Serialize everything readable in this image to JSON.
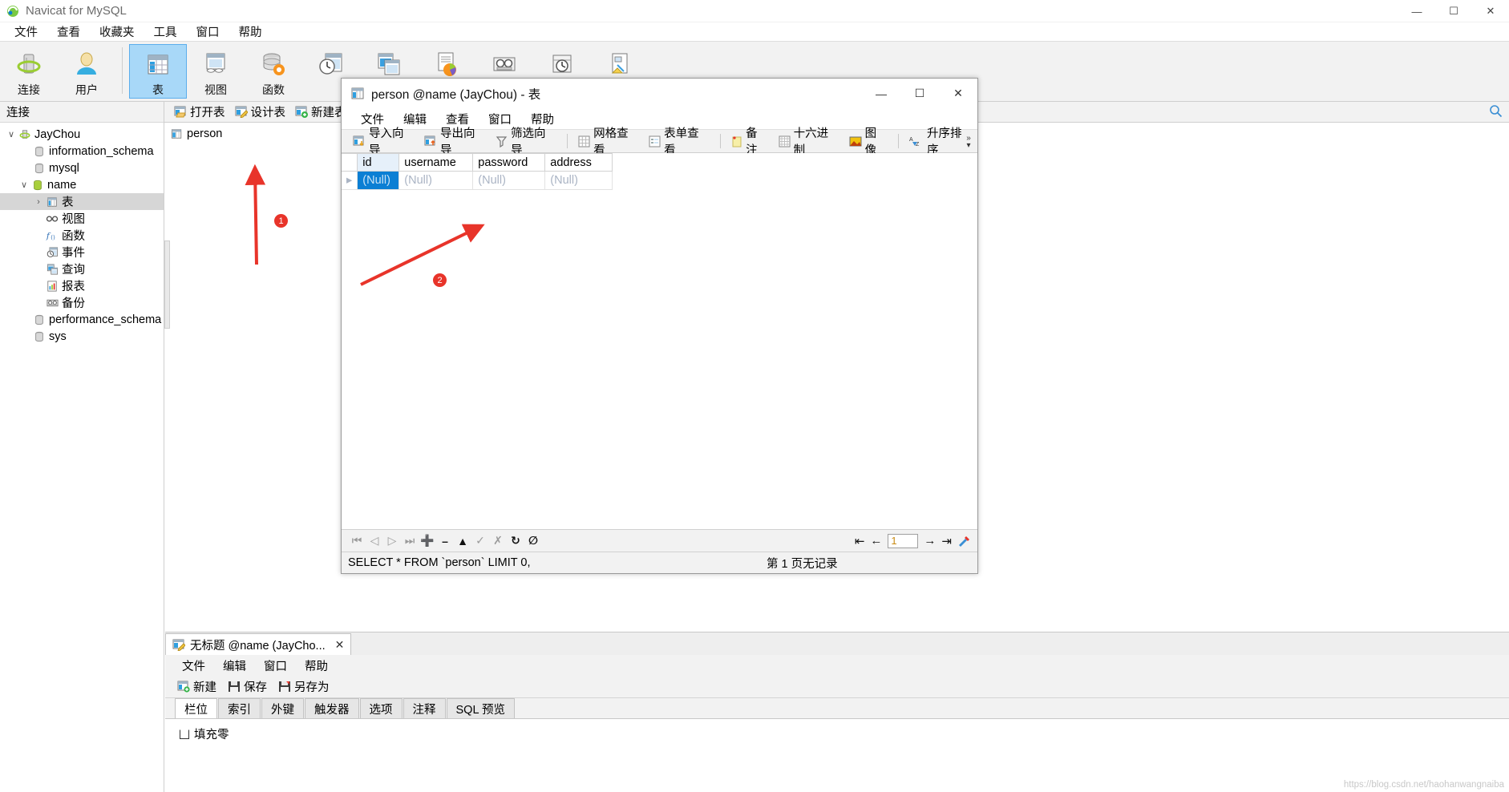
{
  "app": {
    "title": "Navicat for MySQL",
    "icon": "navicat-logo-icon",
    "window_buttons": {
      "minimize": "—",
      "maximize": "☐",
      "close": "✕"
    },
    "menus": [
      "文件",
      "查看",
      "收藏夹",
      "工具",
      "窗口",
      "帮助"
    ],
    "toolbar": [
      {
        "label": "连接",
        "icon": "connection-icon",
        "active": false
      },
      {
        "label": "用户",
        "icon": "user-icon",
        "active": false
      },
      {
        "label": "表",
        "icon": "table-icon",
        "active": true
      },
      {
        "label": "视图",
        "icon": "view-icon",
        "active": false
      },
      {
        "label": "函数",
        "icon": "function-icon",
        "active": false
      },
      {
        "label": "",
        "icon": "event-icon",
        "active": false
      },
      {
        "label": "",
        "icon": "query-icon",
        "active": false
      },
      {
        "label": "",
        "icon": "report-icon",
        "active": false
      },
      {
        "label": "",
        "icon": "backup-icon",
        "active": false
      },
      {
        "label": "",
        "icon": "schedule-icon",
        "active": false
      },
      {
        "label": "",
        "icon": "model-icon",
        "active": false
      }
    ]
  },
  "sidebar": {
    "header": "连接",
    "tree": [
      {
        "label": "JayChou",
        "icon": "connection-icon",
        "indent": 0,
        "twisty": "∨",
        "selected": false
      },
      {
        "label": "information_schema",
        "icon": "database-gray-icon",
        "indent": 1,
        "twisty": "",
        "selected": false
      },
      {
        "label": "mysql",
        "icon": "database-gray-icon",
        "indent": 1,
        "twisty": "",
        "selected": false
      },
      {
        "label": "name",
        "icon": "database-green-icon",
        "indent": 1,
        "twisty": "∨",
        "selected": false
      },
      {
        "label": "表",
        "icon": "table-icon",
        "indent": 2,
        "twisty": "›",
        "selected": true
      },
      {
        "label": "视图",
        "icon": "view-glasses-icon",
        "indent": 2,
        "twisty": "",
        "selected": false
      },
      {
        "label": "函数",
        "icon": "function-fx-icon",
        "indent": 2,
        "twisty": "",
        "selected": false
      },
      {
        "label": "事件",
        "icon": "event-icon",
        "indent": 2,
        "twisty": "",
        "selected": false
      },
      {
        "label": "查询",
        "icon": "query-icon",
        "indent": 2,
        "twisty": "",
        "selected": false
      },
      {
        "label": "报表",
        "icon": "report-icon",
        "indent": 2,
        "twisty": "",
        "selected": false
      },
      {
        "label": "备份",
        "icon": "backup-tape-icon",
        "indent": 2,
        "twisty": "",
        "selected": false
      },
      {
        "label": "performance_schema",
        "icon": "database-gray-icon",
        "indent": 1,
        "twisty": "",
        "selected": false
      },
      {
        "label": "sys",
        "icon": "database-gray-icon",
        "indent": 1,
        "twisty": "",
        "selected": false
      }
    ]
  },
  "main": {
    "toolbar": [
      {
        "label": "打开表",
        "icon": "open-table-icon"
      },
      {
        "label": "设计表",
        "icon": "design-table-icon"
      },
      {
        "label": "新建表",
        "icon": "new-table-icon"
      }
    ],
    "search_icon": "search-icon",
    "objects": [
      {
        "label": "person",
        "icon": "table-icon"
      }
    ]
  },
  "designer": {
    "tab_title": "无标题 @name (JayCho...",
    "tab_icon": "design-table-icon",
    "tab_close": "✕",
    "menus": [
      "文件",
      "编辑",
      "窗口",
      "帮助"
    ],
    "toolbar": [
      {
        "label": "新建",
        "icon": "new-icon"
      },
      {
        "label": "保存",
        "icon": "save-icon"
      },
      {
        "label": "另存为",
        "icon": "save-as-icon"
      }
    ],
    "subtabs": [
      "栏位",
      "索引",
      "外键",
      "触发器",
      "选项",
      "注释",
      "SQL 预览"
    ],
    "active_subtab": "栏位",
    "checkbox_label": "填充零",
    "checkbox_checked": false
  },
  "child_window": {
    "title": "person @name (JayChou) - 表",
    "title_icon": "table-icon",
    "window_buttons": {
      "minimize": "—",
      "maximize": "☐",
      "close": "✕"
    },
    "menus": [
      "文件",
      "编辑",
      "查看",
      "窗口",
      "帮助"
    ],
    "toolbar": [
      {
        "label": "导入向导",
        "icon": "import-wizard-icon",
        "group": 0
      },
      {
        "label": "导出向导",
        "icon": "export-wizard-icon",
        "group": 0
      },
      {
        "label": "筛选向导",
        "icon": "filter-wizard-icon",
        "group": 0
      },
      {
        "label": "网格查看",
        "icon": "grid-view-icon",
        "group": 1
      },
      {
        "label": "表单查看",
        "icon": "form-view-icon",
        "group": 1
      },
      {
        "label": "备注",
        "icon": "memo-icon",
        "group": 2
      },
      {
        "label": "十六进制",
        "icon": "hex-icon",
        "group": 2
      },
      {
        "label": "图像",
        "icon": "image-icon",
        "group": 2
      },
      {
        "label": "升序排序",
        "icon": "sort-asc-icon",
        "group": 3
      }
    ],
    "overflow_icon": "chevron-more-icon",
    "grid": {
      "columns": [
        "id",
        "username",
        "password",
        "address"
      ],
      "rows": [
        {
          "marker": "▸",
          "cells": [
            "(Null)",
            "(Null)",
            "(Null)",
            "(Null)"
          ],
          "selected_cell": 0
        }
      ]
    },
    "navbar": {
      "icons": [
        "first-record-icon",
        "prev-record-icon",
        "next-record-icon",
        "last-record-icon",
        "add-record-icon",
        "delete-record-icon",
        "apply-change-icon",
        "confirm-edit-icon",
        "cancel-edit-icon",
        "refresh-icon",
        "stop-icon"
      ],
      "page_value": "1",
      "page_first": "⇤",
      "page_prev": "←",
      "page_next": "→",
      "page_last": "⇥",
      "tools_icon": "tools-icon"
    },
    "statusbar": {
      "sql": "SELECT * FROM `person` LIMIT 0,",
      "records": "第 1 页无记录"
    }
  },
  "annotations": [
    {
      "id": "1",
      "label": "1"
    },
    {
      "id": "2",
      "label": "2"
    }
  ],
  "watermark": "https://blog.csdn.net/haohanwangnaiba",
  "colors": {
    "accent_blue": "#0b7fd4",
    "toolbar_active": "#a8d8f8",
    "annotation_red": "#e8342a",
    "null_text": "#aab4c4"
  }
}
